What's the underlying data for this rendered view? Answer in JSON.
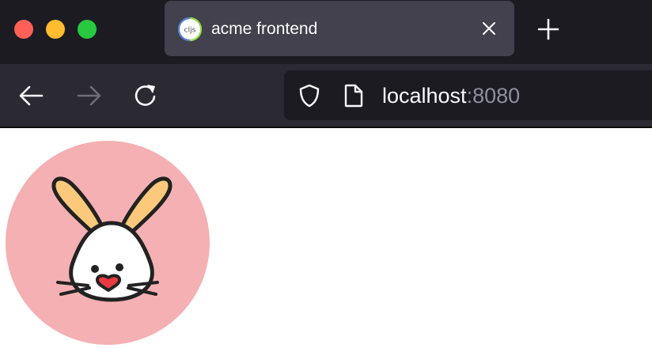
{
  "window": {
    "controls": [
      "close",
      "minimize",
      "maximize"
    ]
  },
  "tab": {
    "title": "acme frontend",
    "favicon": "cljs-icon",
    "favicon_text": "cljs"
  },
  "toolbar": {
    "back_icon": "arrow-left-icon",
    "forward_icon": "arrow-right-icon",
    "reload_icon": "reload-icon"
  },
  "urlbar": {
    "host": "localhost",
    "port": ":8080"
  },
  "page": {
    "logo": "rabbit-logo"
  },
  "colors": {
    "titlebar": "#1c1b22",
    "tab_active": "#42414d",
    "toolbar": "#2b2a33",
    "urlbar": "#1c1b22",
    "logo_bg": "#f4b0b2",
    "rabbit_ear": "#fcc97c",
    "rabbit_nose": "#e83b3f"
  }
}
